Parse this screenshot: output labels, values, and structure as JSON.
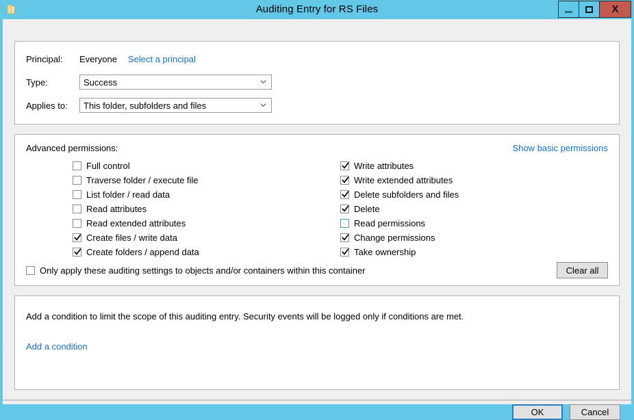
{
  "window": {
    "title": "Auditing Entry for RS Files",
    "icon": "folder-icon",
    "minimize_label": "",
    "maximize_label": "",
    "close_label": "X",
    "titlebar_color": "#63c7e8",
    "close_color": "#c4594f"
  },
  "principal": {
    "principal_label": "Principal:",
    "principal_value": "Everyone",
    "select_principal_link": "Select a principal",
    "type_label": "Type:",
    "type_value": "Success",
    "applies_label": "Applies to:",
    "applies_value": "This folder, subfolders and files"
  },
  "permissions": {
    "title": "Advanced permissions:",
    "toggle_link": "Show basic permissions",
    "link_color": "#1a6fc4",
    "left": [
      {
        "label": "Full control",
        "checked": false,
        "hover": false
      },
      {
        "label": "Traverse folder / execute file",
        "checked": false,
        "hover": false
      },
      {
        "label": "List folder / read data",
        "checked": false,
        "hover": false
      },
      {
        "label": "Read attributes",
        "checked": false,
        "hover": false
      },
      {
        "label": "Read extended attributes",
        "checked": false,
        "hover": false
      },
      {
        "label": "Create files / write data",
        "checked": true,
        "hover": false
      },
      {
        "label": "Create folders / append data",
        "checked": true,
        "hover": false
      }
    ],
    "right": [
      {
        "label": "Write attributes",
        "checked": true,
        "hover": false
      },
      {
        "label": "Write extended attributes",
        "checked": true,
        "hover": false
      },
      {
        "label": "Delete subfolders and files",
        "checked": true,
        "hover": false
      },
      {
        "label": "Delete",
        "checked": true,
        "hover": false
      },
      {
        "label": "Read permissions",
        "checked": false,
        "hover": true
      },
      {
        "label": "Change permissions",
        "checked": true,
        "hover": false
      },
      {
        "label": "Take ownership",
        "checked": true,
        "hover": false
      }
    ],
    "only_apply_label": "Only apply these auditing settings to objects and/or containers within this container",
    "only_apply_checked": false,
    "clear_all_label": "Clear all"
  },
  "conditions": {
    "description": "Add a condition to limit the scope of this auditing entry. Security events will be logged only if conditions are met.",
    "add_condition_link": "Add a condition"
  },
  "footer": {
    "ok_label": "OK",
    "cancel_label": "Cancel",
    "focus_color": "#2a7bbf"
  }
}
